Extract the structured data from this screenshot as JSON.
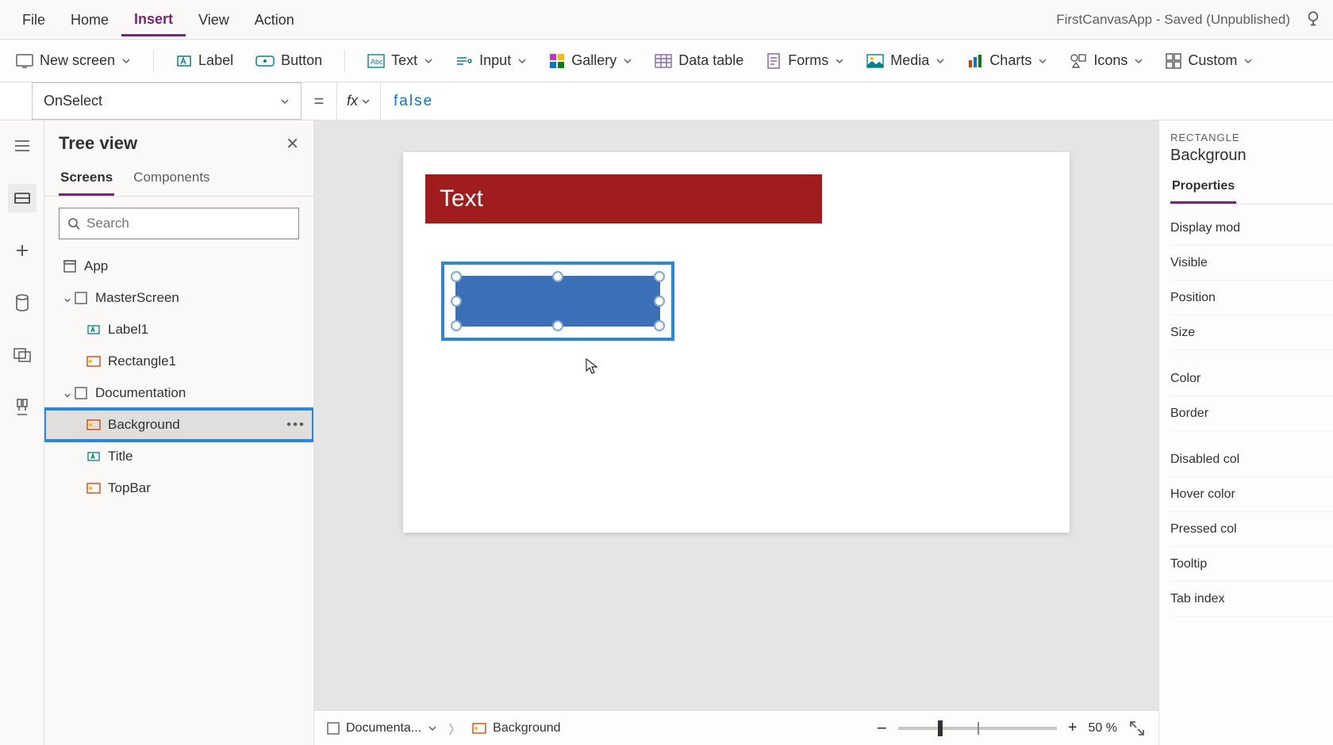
{
  "app_title": "FirstCanvasApp - Saved (Unpublished)",
  "menu": {
    "file": "File",
    "home": "Home",
    "insert": "Insert",
    "view": "View",
    "action": "Action"
  },
  "ribbon": {
    "new_screen": "New screen",
    "label": "Label",
    "button": "Button",
    "text": "Text",
    "input": "Input",
    "gallery": "Gallery",
    "data_table": "Data table",
    "forms": "Forms",
    "media": "Media",
    "charts": "Charts",
    "icons": "Icons",
    "custom": "Custom"
  },
  "formula": {
    "property": "OnSelect",
    "value": "false"
  },
  "tree": {
    "title": "Tree view",
    "tabs": {
      "screens": "Screens",
      "components": "Components"
    },
    "search_placeholder": "Search",
    "app": "App",
    "screens": [
      {
        "name": "MasterScreen",
        "children": [
          {
            "name": "Label1",
            "icon": "label"
          },
          {
            "name": "Rectangle1",
            "icon": "shape"
          }
        ]
      },
      {
        "name": "Documentation",
        "children": [
          {
            "name": "Background",
            "icon": "shape",
            "selected": true
          },
          {
            "name": "Title",
            "icon": "label"
          },
          {
            "name": "TopBar",
            "icon": "shape"
          }
        ]
      }
    ]
  },
  "canvas": {
    "topbar_text": "Text"
  },
  "status": {
    "screen": "Documenta...",
    "selection": "Background",
    "zoom": "50 %"
  },
  "properties": {
    "type": "RECTANGLE",
    "name": "Backgroun",
    "tab": "Properties",
    "rows": [
      "Display mod",
      "Visible",
      "Position",
      "Size",
      "Color",
      "Border",
      "Disabled col",
      "Hover color",
      "Pressed col",
      "Tooltip",
      "Tab index"
    ]
  }
}
